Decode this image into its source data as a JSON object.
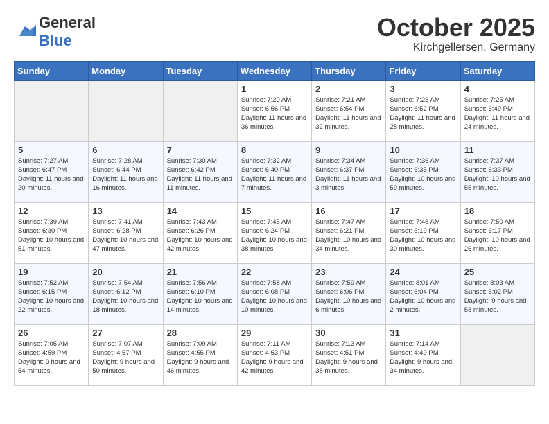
{
  "header": {
    "logo_general": "General",
    "logo_blue": "Blue",
    "month": "October 2025",
    "location": "Kirchgellersen, Germany"
  },
  "days_of_week": [
    "Sunday",
    "Monday",
    "Tuesday",
    "Wednesday",
    "Thursday",
    "Friday",
    "Saturday"
  ],
  "weeks": [
    [
      {
        "day": "",
        "empty": true
      },
      {
        "day": "",
        "empty": true
      },
      {
        "day": "",
        "empty": true
      },
      {
        "day": "1",
        "sunrise": "Sunrise: 7:20 AM",
        "sunset": "Sunset: 6:56 PM",
        "daylight": "Daylight: 11 hours and 36 minutes."
      },
      {
        "day": "2",
        "sunrise": "Sunrise: 7:21 AM",
        "sunset": "Sunset: 6:54 PM",
        "daylight": "Daylight: 11 hours and 32 minutes."
      },
      {
        "day": "3",
        "sunrise": "Sunrise: 7:23 AM",
        "sunset": "Sunset: 6:52 PM",
        "daylight": "Daylight: 11 hours and 28 minutes."
      },
      {
        "day": "4",
        "sunrise": "Sunrise: 7:25 AM",
        "sunset": "Sunset: 6:49 PM",
        "daylight": "Daylight: 11 hours and 24 minutes."
      }
    ],
    [
      {
        "day": "5",
        "sunrise": "Sunrise: 7:27 AM",
        "sunset": "Sunset: 6:47 PM",
        "daylight": "Daylight: 11 hours and 20 minutes."
      },
      {
        "day": "6",
        "sunrise": "Sunrise: 7:28 AM",
        "sunset": "Sunset: 6:44 PM",
        "daylight": "Daylight: 11 hours and 16 minutes."
      },
      {
        "day": "7",
        "sunrise": "Sunrise: 7:30 AM",
        "sunset": "Sunset: 6:42 PM",
        "daylight": "Daylight: 11 hours and 11 minutes."
      },
      {
        "day": "8",
        "sunrise": "Sunrise: 7:32 AM",
        "sunset": "Sunset: 6:40 PM",
        "daylight": "Daylight: 11 hours and 7 minutes."
      },
      {
        "day": "9",
        "sunrise": "Sunrise: 7:34 AM",
        "sunset": "Sunset: 6:37 PM",
        "daylight": "Daylight: 11 hours and 3 minutes."
      },
      {
        "day": "10",
        "sunrise": "Sunrise: 7:36 AM",
        "sunset": "Sunset: 6:35 PM",
        "daylight": "Daylight: 10 hours and 59 minutes."
      },
      {
        "day": "11",
        "sunrise": "Sunrise: 7:37 AM",
        "sunset": "Sunset: 6:33 PM",
        "daylight": "Daylight: 10 hours and 55 minutes."
      }
    ],
    [
      {
        "day": "12",
        "sunrise": "Sunrise: 7:39 AM",
        "sunset": "Sunset: 6:30 PM",
        "daylight": "Daylight: 10 hours and 51 minutes."
      },
      {
        "day": "13",
        "sunrise": "Sunrise: 7:41 AM",
        "sunset": "Sunset: 6:28 PM",
        "daylight": "Daylight: 10 hours and 47 minutes."
      },
      {
        "day": "14",
        "sunrise": "Sunrise: 7:43 AM",
        "sunset": "Sunset: 6:26 PM",
        "daylight": "Daylight: 10 hours and 42 minutes."
      },
      {
        "day": "15",
        "sunrise": "Sunrise: 7:45 AM",
        "sunset": "Sunset: 6:24 PM",
        "daylight": "Daylight: 10 hours and 38 minutes."
      },
      {
        "day": "16",
        "sunrise": "Sunrise: 7:47 AM",
        "sunset": "Sunset: 6:21 PM",
        "daylight": "Daylight: 10 hours and 34 minutes."
      },
      {
        "day": "17",
        "sunrise": "Sunrise: 7:48 AM",
        "sunset": "Sunset: 6:19 PM",
        "daylight": "Daylight: 10 hours and 30 minutes."
      },
      {
        "day": "18",
        "sunrise": "Sunrise: 7:50 AM",
        "sunset": "Sunset: 6:17 PM",
        "daylight": "Daylight: 10 hours and 26 minutes."
      }
    ],
    [
      {
        "day": "19",
        "sunrise": "Sunrise: 7:52 AM",
        "sunset": "Sunset: 6:15 PM",
        "daylight": "Daylight: 10 hours and 22 minutes."
      },
      {
        "day": "20",
        "sunrise": "Sunrise: 7:54 AM",
        "sunset": "Sunset: 6:12 PM",
        "daylight": "Daylight: 10 hours and 18 minutes."
      },
      {
        "day": "21",
        "sunrise": "Sunrise: 7:56 AM",
        "sunset": "Sunset: 6:10 PM",
        "daylight": "Daylight: 10 hours and 14 minutes."
      },
      {
        "day": "22",
        "sunrise": "Sunrise: 7:58 AM",
        "sunset": "Sunset: 6:08 PM",
        "daylight": "Daylight: 10 hours and 10 minutes."
      },
      {
        "day": "23",
        "sunrise": "Sunrise: 7:59 AM",
        "sunset": "Sunset: 6:06 PM",
        "daylight": "Daylight: 10 hours and 6 minutes."
      },
      {
        "day": "24",
        "sunrise": "Sunrise: 8:01 AM",
        "sunset": "Sunset: 6:04 PM",
        "daylight": "Daylight: 10 hours and 2 minutes."
      },
      {
        "day": "25",
        "sunrise": "Sunrise: 8:03 AM",
        "sunset": "Sunset: 6:02 PM",
        "daylight": "Daylight: 9 hours and 58 minutes."
      }
    ],
    [
      {
        "day": "26",
        "sunrise": "Sunrise: 7:05 AM",
        "sunset": "Sunset: 4:59 PM",
        "daylight": "Daylight: 9 hours and 54 minutes."
      },
      {
        "day": "27",
        "sunrise": "Sunrise: 7:07 AM",
        "sunset": "Sunset: 4:57 PM",
        "daylight": "Daylight: 9 hours and 50 minutes."
      },
      {
        "day": "28",
        "sunrise": "Sunrise: 7:09 AM",
        "sunset": "Sunset: 4:55 PM",
        "daylight": "Daylight: 9 hours and 46 minutes."
      },
      {
        "day": "29",
        "sunrise": "Sunrise: 7:11 AM",
        "sunset": "Sunset: 4:53 PM",
        "daylight": "Daylight: 9 hours and 42 minutes."
      },
      {
        "day": "30",
        "sunrise": "Sunrise: 7:13 AM",
        "sunset": "Sunset: 4:51 PM",
        "daylight": "Daylight: 9 hours and 38 minutes."
      },
      {
        "day": "31",
        "sunrise": "Sunrise: 7:14 AM",
        "sunset": "Sunset: 4:49 PM",
        "daylight": "Daylight: 9 hours and 34 minutes."
      },
      {
        "day": "",
        "empty": true
      }
    ]
  ]
}
